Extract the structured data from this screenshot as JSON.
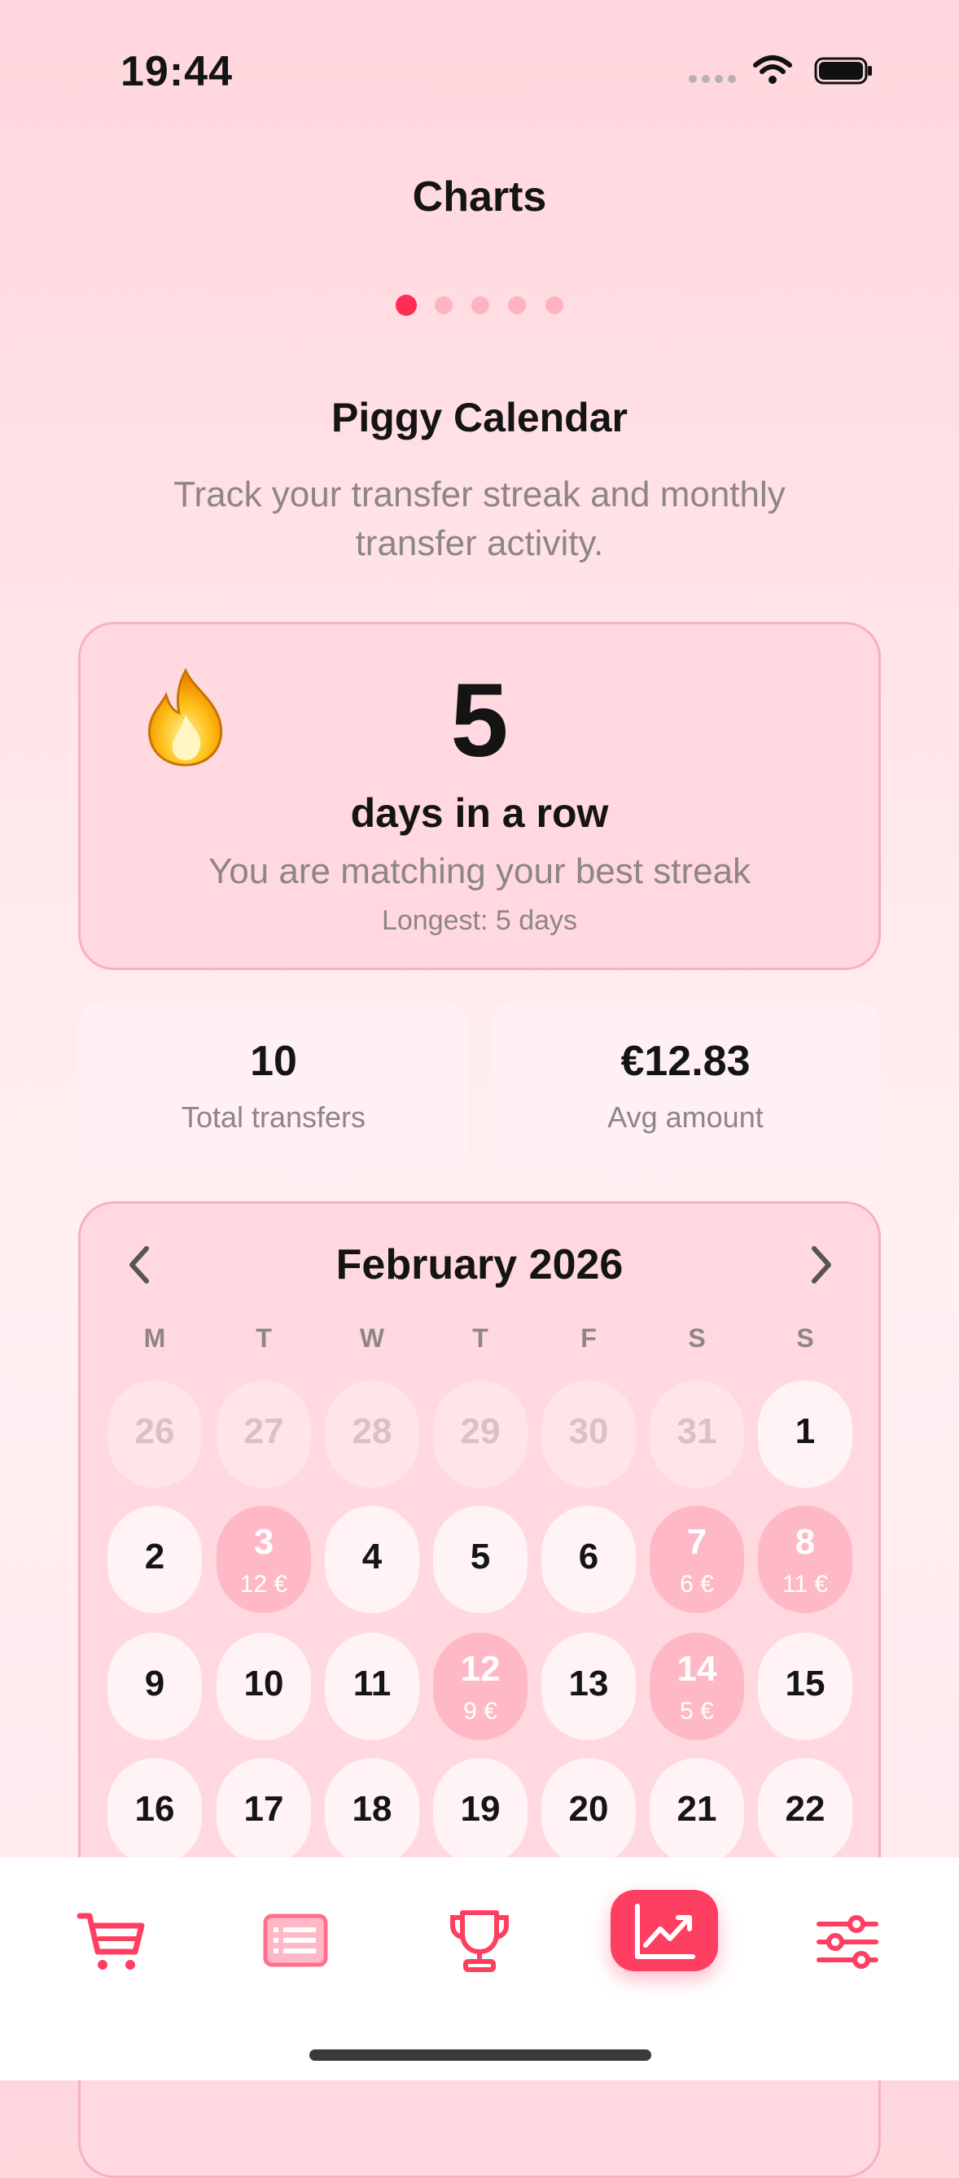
{
  "status_bar": {
    "time": "19:44"
  },
  "header": {
    "title": "Charts"
  },
  "pager": {
    "count": 5,
    "active_index": 0
  },
  "section": {
    "title": "Piggy Calendar",
    "description": "Track your transfer streak and monthly transfer activity."
  },
  "streak": {
    "value": "5",
    "label": "days in a row",
    "subtitle": "You are matching your best streak",
    "longest": "Longest: 5 days"
  },
  "stats": {
    "total": {
      "value": "10",
      "label": "Total transfers"
    },
    "avg": {
      "value": "€12.83",
      "label": "Avg amount"
    }
  },
  "calendar": {
    "month": "February 2026",
    "weekdays": [
      "M",
      "T",
      "W",
      "T",
      "F",
      "S",
      "S"
    ],
    "rows": [
      [
        {
          "d": "26",
          "muted": true
        },
        {
          "d": "27",
          "muted": true
        },
        {
          "d": "28",
          "muted": true
        },
        {
          "d": "29",
          "muted": true
        },
        {
          "d": "30",
          "muted": true
        },
        {
          "d": "31",
          "muted": true
        },
        {
          "d": "1"
        }
      ],
      [
        {
          "d": "2"
        },
        {
          "d": "3",
          "amount": "12 €"
        },
        {
          "d": "4"
        },
        {
          "d": "5"
        },
        {
          "d": "6"
        },
        {
          "d": "7",
          "amount": "6 €"
        },
        {
          "d": "8",
          "amount": "11 €"
        }
      ],
      [
        {
          "d": "9"
        },
        {
          "d": "10"
        },
        {
          "d": "11"
        },
        {
          "d": "12",
          "amount": "9 €"
        },
        {
          "d": "13"
        },
        {
          "d": "14",
          "amount": "5 €"
        },
        {
          "d": "15"
        }
      ],
      [
        {
          "d": "16"
        },
        {
          "d": "17"
        },
        {
          "d": "18"
        },
        {
          "d": "19"
        },
        {
          "d": "20"
        },
        {
          "d": "21"
        },
        {
          "d": "22"
        }
      ]
    ]
  },
  "tabbar": {
    "tabs": [
      {
        "icon": "cart-icon"
      },
      {
        "icon": "list-icon"
      },
      {
        "icon": "trophy-icon"
      },
      {
        "icon": "chart-icon",
        "active": true
      },
      {
        "icon": "sliders-icon"
      }
    ]
  },
  "colors": {
    "accent": "#ff3f62",
    "active_dot": "#ff2d55"
  }
}
